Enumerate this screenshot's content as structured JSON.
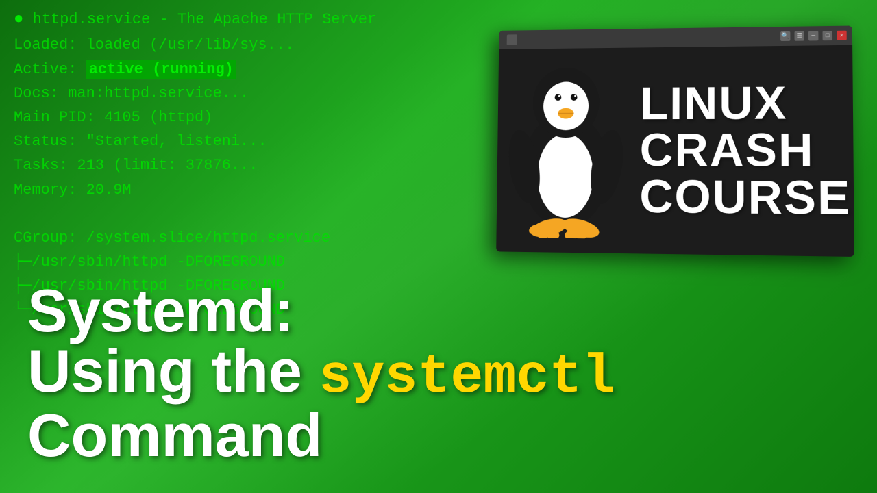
{
  "background": {
    "color_primary": "#1a8c1a",
    "color_secondary": "#0d6e0d"
  },
  "terminal": {
    "lines": [
      {
        "id": "line1",
        "text": "● httpd.service - The Apache HTTP Server",
        "type": "header"
      },
      {
        "id": "line2",
        "label": "     Loaded:",
        "value": " loaded (/usr/lib/sys..."
      },
      {
        "id": "line3",
        "label": "     Active:",
        "value": " active (running)",
        "highlighted": true
      },
      {
        "id": "line4",
        "label": "       Docs:",
        "value": " man:httpd.service..."
      },
      {
        "id": "line5",
        "label": "   Main PID:",
        "value": " 4105 (httpd)"
      },
      {
        "id": "line6",
        "label": "     Status:",
        "value": " \"Started, listeni..."
      },
      {
        "id": "line7",
        "label": "      Tasks:",
        "value": " 213 (limit: 37876..."
      },
      {
        "id": "line8",
        "label": "     Memory:",
        "value": " 20.9M..."
      },
      {
        "id": "line9",
        "label": "      CGroup:",
        "value": " /system.slice/httpd.service"
      },
      {
        "id": "line10",
        "text": "              ├─/usr/sbin/httpd -DFOREGROUND"
      },
      {
        "id": "line11",
        "text": "              ├─/usr/sbin/httpd -DFOREGROUND"
      },
      {
        "id": "line12",
        "text": "              └─/usr/sbin/httpd -DFOREGROUND"
      }
    ]
  },
  "title": {
    "line1": "Systemd:",
    "line2_prefix": "Using the ",
    "line2_cmd": "systemctl",
    "line3": "Command"
  },
  "lcc_card": {
    "title_line1": "LINUX",
    "title_line2": "CRASH",
    "title_line3": "COURSE",
    "window_buttons": [
      "search",
      "menu",
      "minimize",
      "maximize",
      "close"
    ]
  }
}
